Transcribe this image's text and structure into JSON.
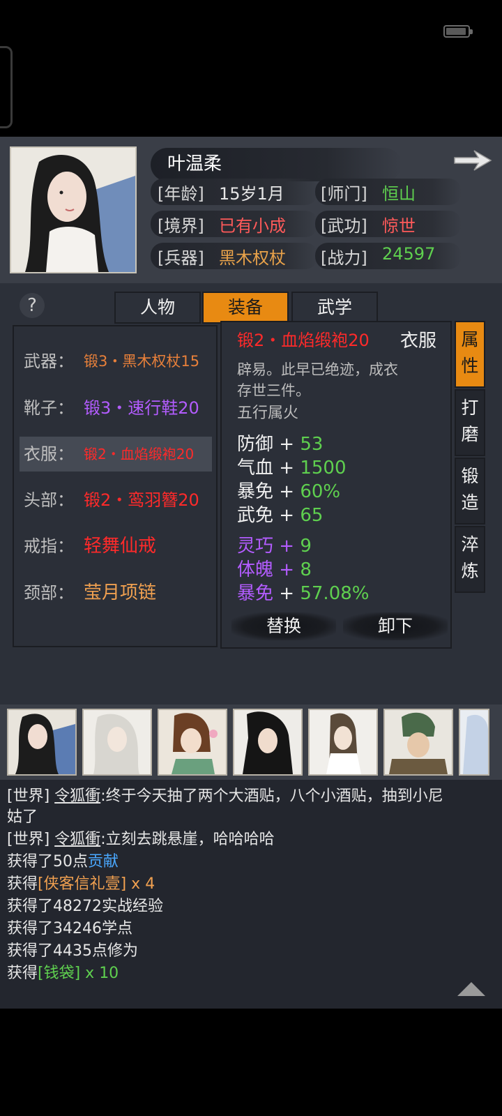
{
  "character": {
    "name": "叶温柔",
    "age_label": "[年龄]",
    "age": "15岁1月",
    "sect_label": "[师门]",
    "sect": "恒山",
    "realm_label": "[境界]",
    "realm": "已有小成",
    "martial_label": "[武功]",
    "martial": "惊世",
    "weapon_label": "[兵器]",
    "weapon": "黑木权杖",
    "power_label": "[战力]",
    "power": "24597"
  },
  "help_label": "?",
  "tabs": [
    {
      "label": "人物",
      "active": false
    },
    {
      "label": "装备",
      "active": true
    },
    {
      "label": "武学",
      "active": false
    }
  ],
  "slots": [
    {
      "label": "武器：",
      "item": "锻3・黑木权杖15",
      "color": "#e8803a"
    },
    {
      "label": "靴子：",
      "item": "锻3・速行鞋20",
      "color": "#b35cff"
    },
    {
      "label": "衣服：",
      "item": "锻2・血焰缎袍20",
      "color": "#ff2a2a",
      "selected": true
    },
    {
      "label": "头部：",
      "item": "锻2・鸾羽簪20",
      "color": "#ff2a2a"
    },
    {
      "label": "戒指：",
      "item": "轻舞仙戒",
      "color": "#ff2a2a"
    },
    {
      "label": "颈部：",
      "item": "莹月项链",
      "color": "#f0a050"
    }
  ],
  "detail": {
    "title": "锻2・血焰缎袍20",
    "type": "衣服",
    "desc1": "辟易。此早已绝迹，成衣",
    "desc2": "存世三件。",
    "element": "五行属火",
    "base_stats": [
      {
        "name": "防御",
        "plus": " + ",
        "value": "53"
      },
      {
        "name": "气血",
        "plus": " + ",
        "value": "1500"
      },
      {
        "name": "暴免",
        "plus": " + ",
        "value": "60%"
      },
      {
        "name": "武免",
        "plus": " + ",
        "value": "65"
      }
    ],
    "bonus_stats": [
      {
        "name": "灵巧",
        "plus": " + ",
        "value": "9"
      },
      {
        "name": "体魄",
        "plus": " + ",
        "value": "8"
      },
      {
        "name": "暴免",
        "plus": " + ",
        "value": "57.08%"
      }
    ],
    "replace_label": "替换",
    "unequip_label": "卸下"
  },
  "side_tabs": [
    {
      "chars": "属性",
      "active": true
    },
    {
      "chars": "打磨",
      "active": false
    },
    {
      "chars": "锻造",
      "active": false
    },
    {
      "chars": "淬炼",
      "active": false
    }
  ],
  "chat": {
    "lines": [
      {
        "prefix": "[世界]",
        "user": "令狐衝",
        "text": ":终于今天抽了两个大酒贴，八个小酒贴，抽到小尼"
      },
      {
        "text": "姑了"
      },
      {
        "prefix": "[世界]",
        "user": "令狐衝",
        "text": ":立刻去跳悬崖，哈哈哈哈"
      },
      {
        "a": "获得了50点",
        "b": "贡献"
      },
      {
        "a": "获得",
        "b": "[侠客信礼壹] x 4"
      },
      {
        "a": "获得了48272实战经验"
      },
      {
        "a": "获得了34246学点"
      },
      {
        "a": "获得了4435点修为"
      },
      {
        "a": "获得",
        "b": "[钱袋] x 10"
      }
    ]
  }
}
